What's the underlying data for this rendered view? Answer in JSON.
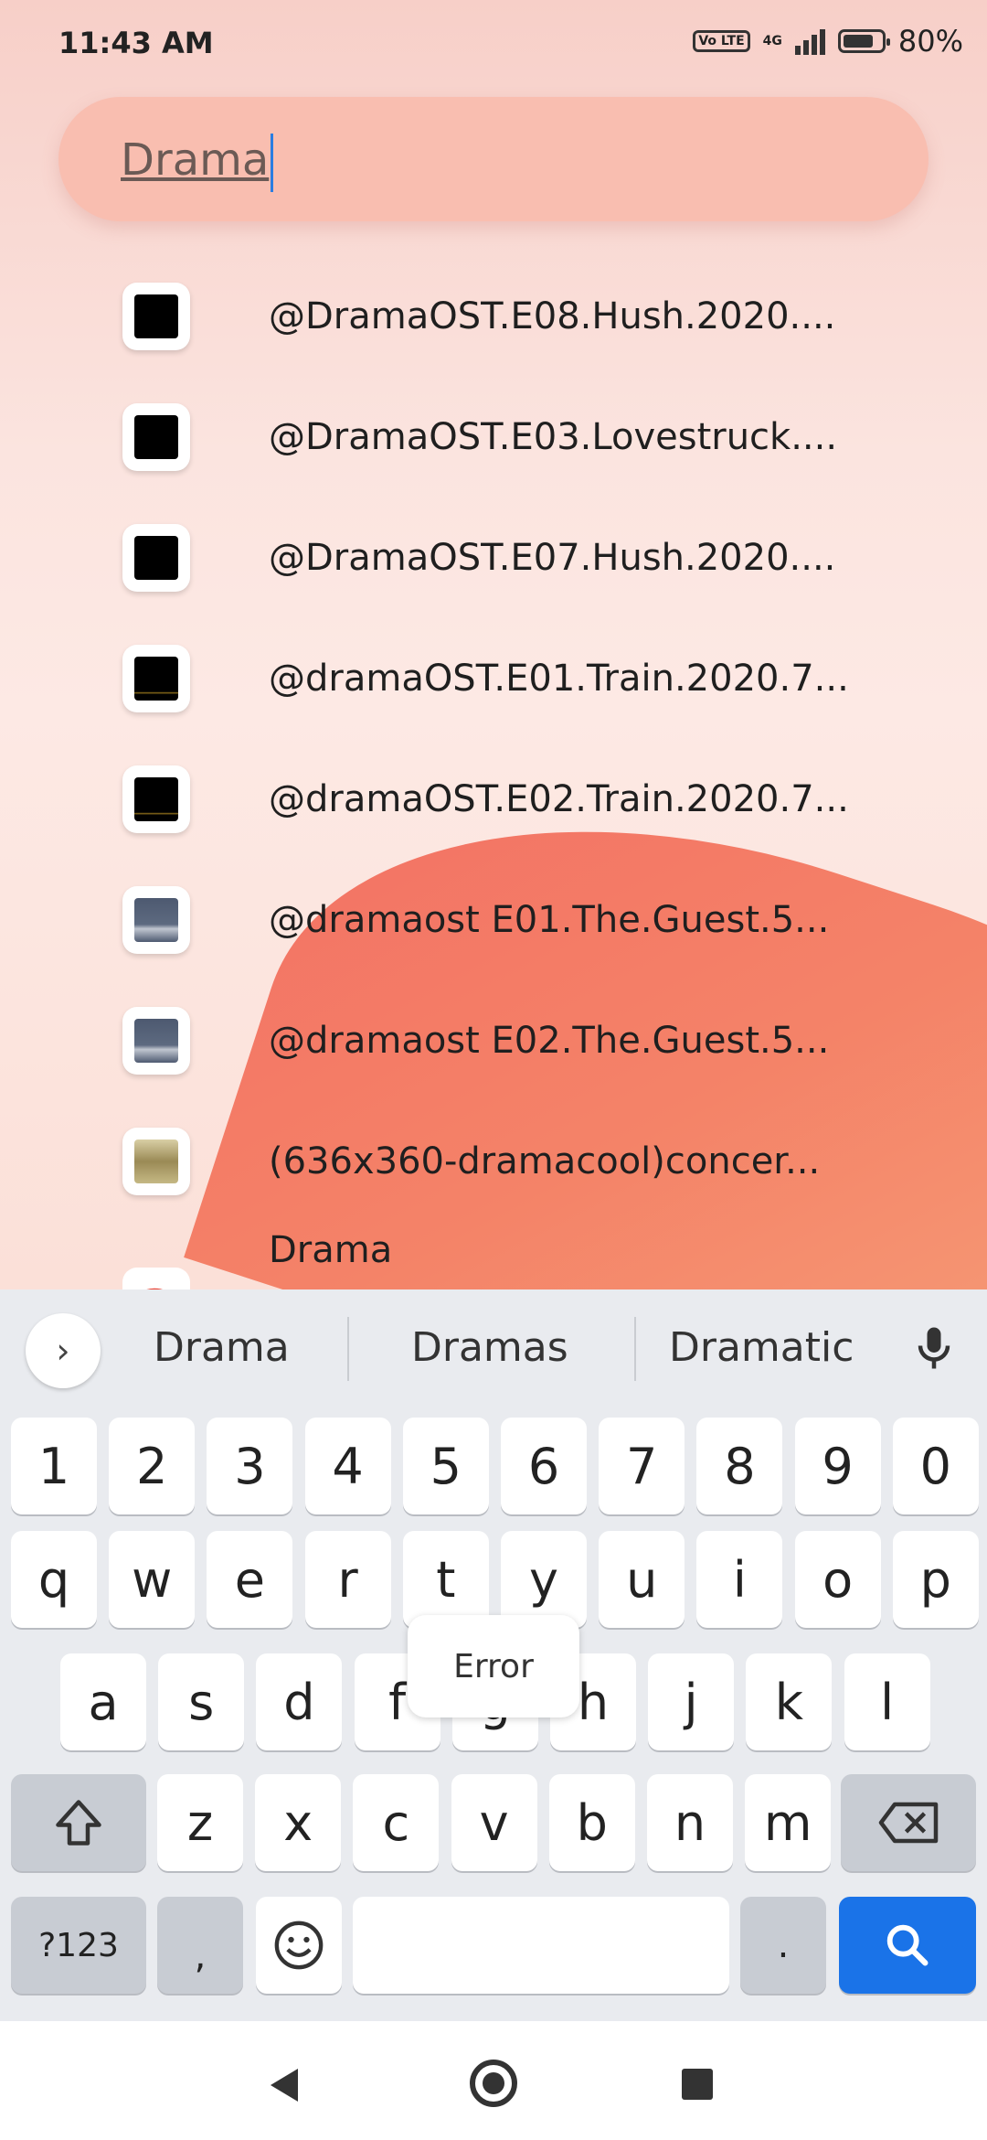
{
  "status_bar": {
    "time": "11:43 AM",
    "network": "4G",
    "volte": "Vo LTE",
    "battery": "80%",
    "battery_level": 0.8
  },
  "search": {
    "query": "Drama"
  },
  "results": [
    {
      "label": "@DramaOST.E08.Hush.2020....",
      "thumb": "black"
    },
    {
      "label": "@DramaOST.E03.Lovestruck....",
      "thumb": "black"
    },
    {
      "label": "@DramaOST.E07.Hush.2020....",
      "thumb": "black"
    },
    {
      "label": "@dramaOST.E01.Train.2020.7...",
      "thumb": "dark-gold"
    },
    {
      "label": "@dramaOST.E02.Train.2020.7...",
      "thumb": "dark-gold"
    },
    {
      "label": "@dramaost E01.The.Guest.5...",
      "thumb": "gray"
    },
    {
      "label": "@dramaost E02.The.Guest.5...",
      "thumb": "gray"
    },
    {
      "label": "(636x360-dramacool)concer...",
      "thumb": "poster"
    }
  ],
  "web_suggestion": {
    "label": "Drama",
    "icon": "google-icon"
  },
  "keyboard": {
    "suggestions": [
      "Drama",
      "Dramas",
      "Dramatic"
    ],
    "row_numbers": [
      "1",
      "2",
      "3",
      "4",
      "5",
      "6",
      "7",
      "8",
      "9",
      "0"
    ],
    "row_1": [
      "q",
      "w",
      "e",
      "r",
      "t",
      "y",
      "u",
      "i",
      "o",
      "p"
    ],
    "row_2": [
      "a",
      "s",
      "d",
      "f",
      "g",
      "h",
      "j",
      "k",
      "l"
    ],
    "row_3": [
      "z",
      "x",
      "c",
      "v",
      "b",
      "n",
      "m"
    ],
    "symbols_label": "?123",
    "comma_label": ",",
    "period_label": ".",
    "error_popup": "Error"
  }
}
